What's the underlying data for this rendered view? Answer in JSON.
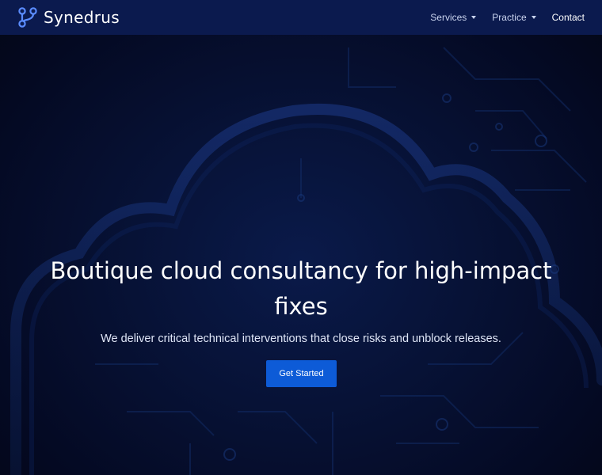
{
  "brand": {
    "name": "Synedrus",
    "logo_icon": "git-branch-icon"
  },
  "nav": {
    "items": [
      {
        "label": "Services",
        "has_dropdown": true
      },
      {
        "label": "Practice",
        "has_dropdown": true
      },
      {
        "label": "Contact",
        "has_dropdown": false
      }
    ]
  },
  "hero": {
    "title": "Boutique cloud consultancy for high-impact fixes",
    "subtitle": "We deliver critical technical interventions that close risks and unblock releases.",
    "cta_label": "Get Started"
  },
  "colors": {
    "nav_bg": "#0b1a4e",
    "page_bg": "#050a1f",
    "cta_bg": "#0d5bd7",
    "logo_accent": "#5b8cff"
  }
}
